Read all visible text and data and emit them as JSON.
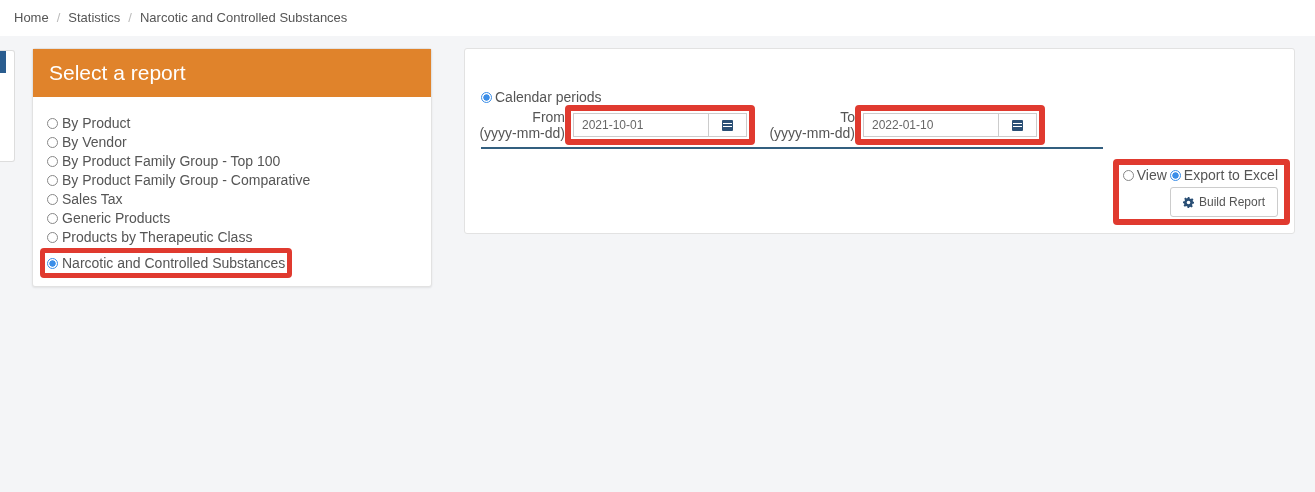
{
  "breadcrumb": [
    "Home",
    "Statistics",
    "Narcotic and Controlled Substances"
  ],
  "breadcrumb_separator": "/",
  "report_panel": {
    "title": "Select a report",
    "options": [
      {
        "label": "By Product",
        "selected": false,
        "highlighted": false
      },
      {
        "label": "By Vendor",
        "selected": false,
        "highlighted": false
      },
      {
        "label": "By Product Family Group - Top 100",
        "selected": false,
        "highlighted": false
      },
      {
        "label": "By Product Family Group - Comparative",
        "selected": false,
        "highlighted": false
      },
      {
        "label": "Sales Tax",
        "selected": false,
        "highlighted": false
      },
      {
        "label": "Generic Products",
        "selected": false,
        "highlighted": false
      },
      {
        "label": "Products by Therapeutic Class",
        "selected": false,
        "highlighted": false
      },
      {
        "label": "Narcotic and Controlled Substances",
        "selected": true,
        "highlighted": true
      }
    ]
  },
  "period": {
    "label": "Calendar periods",
    "selected": true,
    "fields": [
      {
        "label": "From",
        "hint": "(yyyy-mm-dd)",
        "value": "2021-10-01",
        "highlighted": true
      },
      {
        "label": "To",
        "hint": "(yyyy-mm-dd)",
        "value": "2022-01-10",
        "highlighted": true
      }
    ]
  },
  "output": {
    "highlighted": true,
    "options": [
      {
        "label": "View",
        "selected": false
      },
      {
        "label": "Export to Excel",
        "selected": true
      }
    ],
    "button": "Build Report"
  }
}
